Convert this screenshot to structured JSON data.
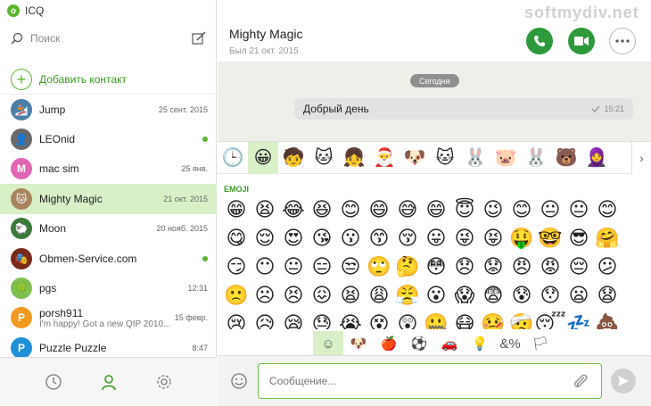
{
  "app": {
    "title": "ICQ",
    "watermark": "softmydiv.net"
  },
  "search": {
    "placeholder": "Поиск"
  },
  "add_contact": {
    "label": "Добавить контакт"
  },
  "contacts": [
    {
      "name": "Jump",
      "date": "25 сент. 2015",
      "avatar_color": "#4a7fa8",
      "online": false
    },
    {
      "name": "LEOnid",
      "date": "",
      "avatar_color": "#6a6a6a",
      "online": true
    },
    {
      "name": "mac sim",
      "date": "25 янв.",
      "avatar_letter": "M",
      "avatar_color": "#e066b3",
      "online": false
    },
    {
      "name": "Mighty Magic",
      "date": "21 окт. 2015",
      "avatar_color": "#a88560",
      "online": false,
      "selected": true
    },
    {
      "name": "Moon",
      "date": "20 нояб. 2015",
      "avatar_color": "#3a7a3a",
      "online": false
    },
    {
      "name": "Obmen-Service.com",
      "date": "",
      "avatar_color": "#7a2a1a",
      "online": true
    },
    {
      "name": "pgs",
      "date": "12:31",
      "avatar_color": "#7fbf4f",
      "online": false
    },
    {
      "name": "porsh911",
      "preview": "I'm happy! Got a new QIP 2010...",
      "date": "15 февр.",
      "avatar_letter": "P",
      "avatar_color": "#f29a1f",
      "online": false
    },
    {
      "name": "Puzzle Puzzle",
      "date": "8:47",
      "avatar_letter": "P",
      "avatar_color": "#1f8fd8",
      "online": false
    }
  ],
  "chat": {
    "name": "Mighty Magic",
    "status": "Был 21 окт. 2015",
    "date_divider": "Сегодня",
    "message": {
      "text": "Добрый день",
      "time": "15:21"
    }
  },
  "picker": {
    "section_label": "EMOJI",
    "packs": [
      "🕒",
      "😀",
      "🧒",
      "🐱",
      "👧",
      "🎅",
      "🐶",
      "🐱",
      "🐰",
      "🐷",
      "🐰",
      "🐻",
      "🧕"
    ],
    "emojis": [
      "😁",
      "😫",
      "😂",
      "😆",
      "😊",
      "😄",
      "😅",
      "😄",
      "😇",
      "😉",
      "😊",
      "😐",
      "😐",
      "😊",
      "😋",
      "😌",
      "😍",
      "😘",
      "😗",
      "😙",
      "😚",
      "😛",
      "😜",
      "😝",
      "🤑",
      "🤓",
      "😎",
      "🤗",
      "😏",
      "😶",
      "😐",
      "😑",
      "😒",
      "🙄",
      "🤔",
      "😳",
      "😞",
      "😟",
      "😠",
      "😡",
      "😔",
      "😕",
      "🙁",
      "☹",
      "😣",
      "😖",
      "😫",
      "😩",
      "😤",
      "😮",
      "😱",
      "😨",
      "😰",
      "😯",
      "😦",
      "😧",
      "😢",
      "😥",
      "😪",
      "😓",
      "😭",
      "😵",
      "😲",
      "🤐",
      "😷",
      "🤒",
      "🤕",
      "😴",
      "💤",
      "💩"
    ],
    "categories": [
      "☺",
      "🐶",
      "🍎",
      "⚽",
      "🚗",
      "💡",
      "&%",
      "🏳"
    ]
  },
  "composer": {
    "placeholder": "Сообщение..."
  }
}
